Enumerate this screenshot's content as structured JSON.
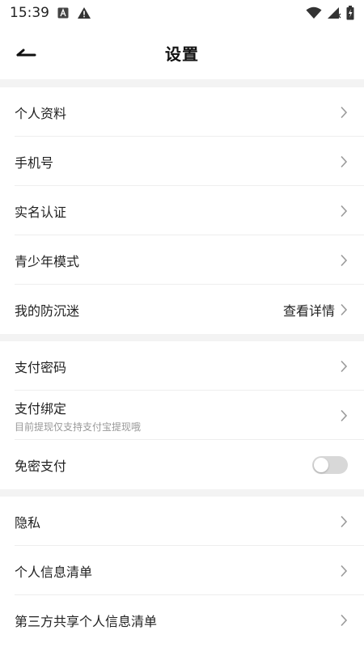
{
  "status_bar": {
    "time": "15:39",
    "icons": [
      "text-a-icon",
      "warning-icon",
      "wifi-icon",
      "signal-icon",
      "battery-icon"
    ]
  },
  "header": {
    "title": "设置",
    "back_icon": "back-arrow-icon"
  },
  "sections": [
    {
      "items": [
        {
          "label": "个人资料"
        },
        {
          "label": "手机号"
        },
        {
          "label": "实名认证"
        },
        {
          "label": "青少年模式"
        },
        {
          "label": "我的防沉迷",
          "value": "查看详情"
        }
      ]
    },
    {
      "items": [
        {
          "label": "支付密码"
        },
        {
          "label": "支付绑定",
          "subtitle": "目前提现仅支持支付宝提现哦"
        },
        {
          "label": "免密支付",
          "toggle": false
        }
      ]
    },
    {
      "items": [
        {
          "label": "隐私"
        },
        {
          "label": "个人信息清单"
        },
        {
          "label": "第三方共享个人信息清单"
        }
      ]
    }
  ],
  "colors": {
    "background": "#ffffff",
    "section_gap": "#f3f3f3",
    "text": "#222222",
    "subtext": "#999999",
    "chevron": "#9a9a9a",
    "toggle_off": "#d8d8d8"
  }
}
